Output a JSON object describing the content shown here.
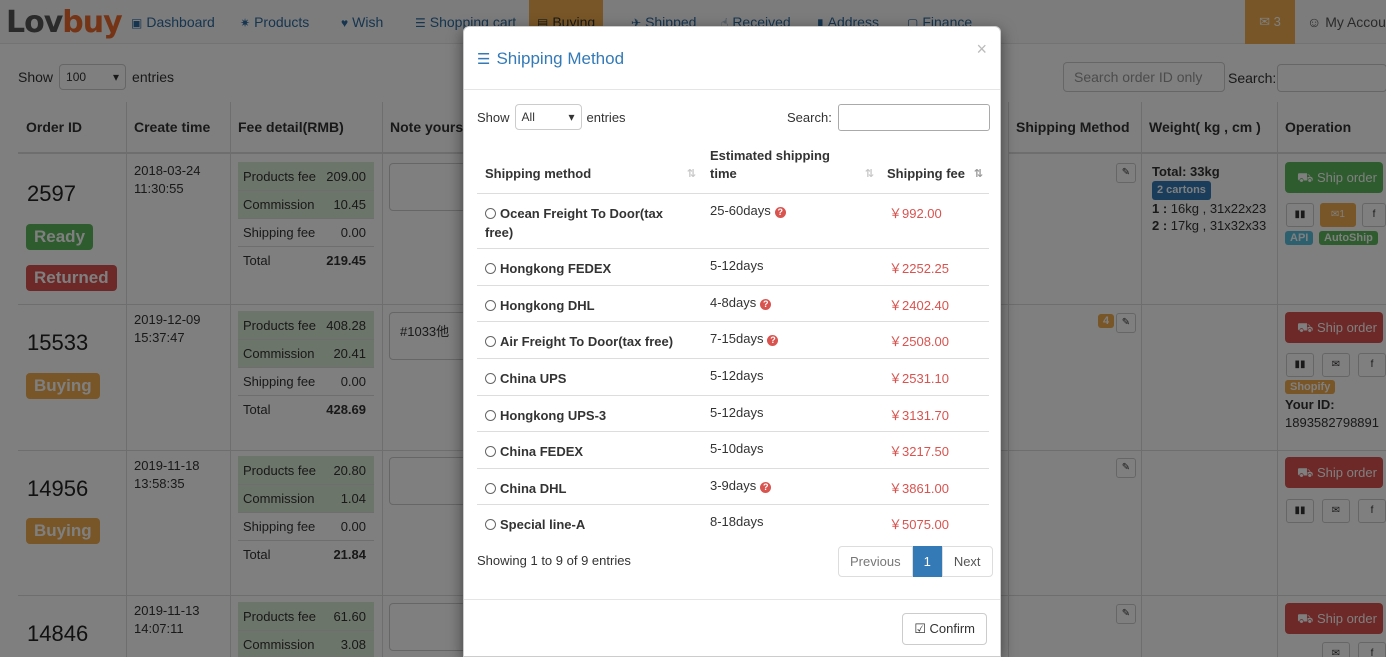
{
  "brand": {
    "part1": "Lov",
    "part2": "buy"
  },
  "nav": [
    {
      "icon": "▣",
      "label": "Dashboard"
    },
    {
      "icon": "✷",
      "label": "Products"
    },
    {
      "icon": "♥",
      "label": "Wish"
    },
    {
      "icon": "☰",
      "label": "Shopping cart"
    },
    {
      "icon": "▤",
      "label": "Buying"
    },
    {
      "icon": "✈",
      "label": "Shipped"
    },
    {
      "icon": "☝",
      "label": "Received"
    },
    {
      "icon": "▮",
      "label": "Address"
    },
    {
      "icon": "▢",
      "label": "Finance"
    }
  ],
  "messages": {
    "icon": "✉",
    "count": "3"
  },
  "account": {
    "icon": "☺",
    "label": "My Account"
  },
  "list": {
    "show_label": "Show",
    "entries_value": "100",
    "entries_label": "entries",
    "search_placeholder": "Search order ID only",
    "search_label": "Search:"
  },
  "headers": {
    "order_id": "Order ID",
    "create_time": "Create time",
    "fee_detail": "Fee detail(RMB)",
    "note": "Note yourself",
    "shipping": "Shipping Method",
    "weight": "Weight( kg , cm )",
    "operation": "Operation"
  },
  "orders": [
    {
      "id": "2597",
      "status": "Ready",
      "status2": "Returned",
      "date": "2018-03-24",
      "time": "11:30:55",
      "fees": [
        [
          "Products fee",
          "209.00"
        ],
        [
          "Commission",
          "10.45"
        ],
        [
          "Shipping fee",
          "0.00"
        ],
        [
          "Total",
          "219.45"
        ]
      ],
      "note": "",
      "weight_total": "Total: 33kg",
      "cartons": "2 cartons",
      "c1": "16kg , 31x22x23",
      "c2": "17kg , 31x32x33",
      "ship_label": "Ship order",
      "msg_count": "1",
      "api": "API",
      "autoship": "AutoShip"
    },
    {
      "id": "15533",
      "status": "Buying",
      "date": "2019-12-09",
      "time": "15:37:47",
      "fees": [
        [
          "Products fee",
          "408.28"
        ],
        [
          "Commission",
          "20.41"
        ],
        [
          "Shipping fee",
          "0.00"
        ],
        [
          "Total",
          "428.69"
        ]
      ],
      "note": "#1033他",
      "count_badge": "4",
      "ship_label": "Ship order",
      "shopify": "Shopify",
      "your_id_label": "Your ID:",
      "your_id": "1893582798891"
    },
    {
      "id": "14956",
      "status": "Buying",
      "date": "2019-11-18",
      "time": "13:58:35",
      "fees": [
        [
          "Products fee",
          "20.80"
        ],
        [
          "Commission",
          "1.04"
        ],
        [
          "Shipping fee",
          "0.00"
        ],
        [
          "Total",
          "21.84"
        ]
      ],
      "note": "",
      "ship_label": "Ship order"
    },
    {
      "id": "14846",
      "status": "Buying",
      "date": "2019-11-13",
      "time": "14:07:11",
      "fees": [
        [
          "Products fee",
          "61.60"
        ],
        [
          "Commission",
          "3.08"
        ]
      ],
      "note": "",
      "ship_label": "Ship order"
    }
  ],
  "modal": {
    "title": "Shipping Method",
    "close": "×",
    "show_label": "Show",
    "entries_value": "All",
    "entries_label": "entries",
    "search_label": "Search:",
    "col_method": "Shipping method",
    "col_time": "Estimated shipping time",
    "col_fee": "Shipping fee",
    "rows": [
      {
        "method": "Ocean Freight To Door(tax free)",
        "time": "25-60days",
        "help": true,
        "fee": "￥992.00"
      },
      {
        "method": "Hongkong FEDEX",
        "time": "5-12days",
        "help": false,
        "fee": "￥2252.25"
      },
      {
        "method": "Hongkong DHL",
        "time": "4-8days",
        "help": true,
        "fee": "￥2402.40"
      },
      {
        "method": "Air Freight To Door(tax free)",
        "time": "7-15days",
        "help": true,
        "fee": "￥2508.00"
      },
      {
        "method": "China UPS",
        "time": "5-12days",
        "help": false,
        "fee": "￥2531.10"
      },
      {
        "method": "Hongkong UPS-3",
        "time": "5-12days",
        "help": false,
        "fee": "￥3131.70"
      },
      {
        "method": "China FEDEX",
        "time": "5-10days",
        "help": false,
        "fee": "￥3217.50"
      },
      {
        "method": "China DHL",
        "time": "3-9days",
        "help": true,
        "fee": "￥3861.00"
      },
      {
        "method": "Special line-A",
        "time": "8-18days",
        "help": false,
        "fee": "￥5075.00"
      }
    ],
    "info": "Showing 1 to 9 of 9 entries",
    "prev": "Previous",
    "page": "1",
    "next": "Next",
    "confirm": "Confirm"
  }
}
